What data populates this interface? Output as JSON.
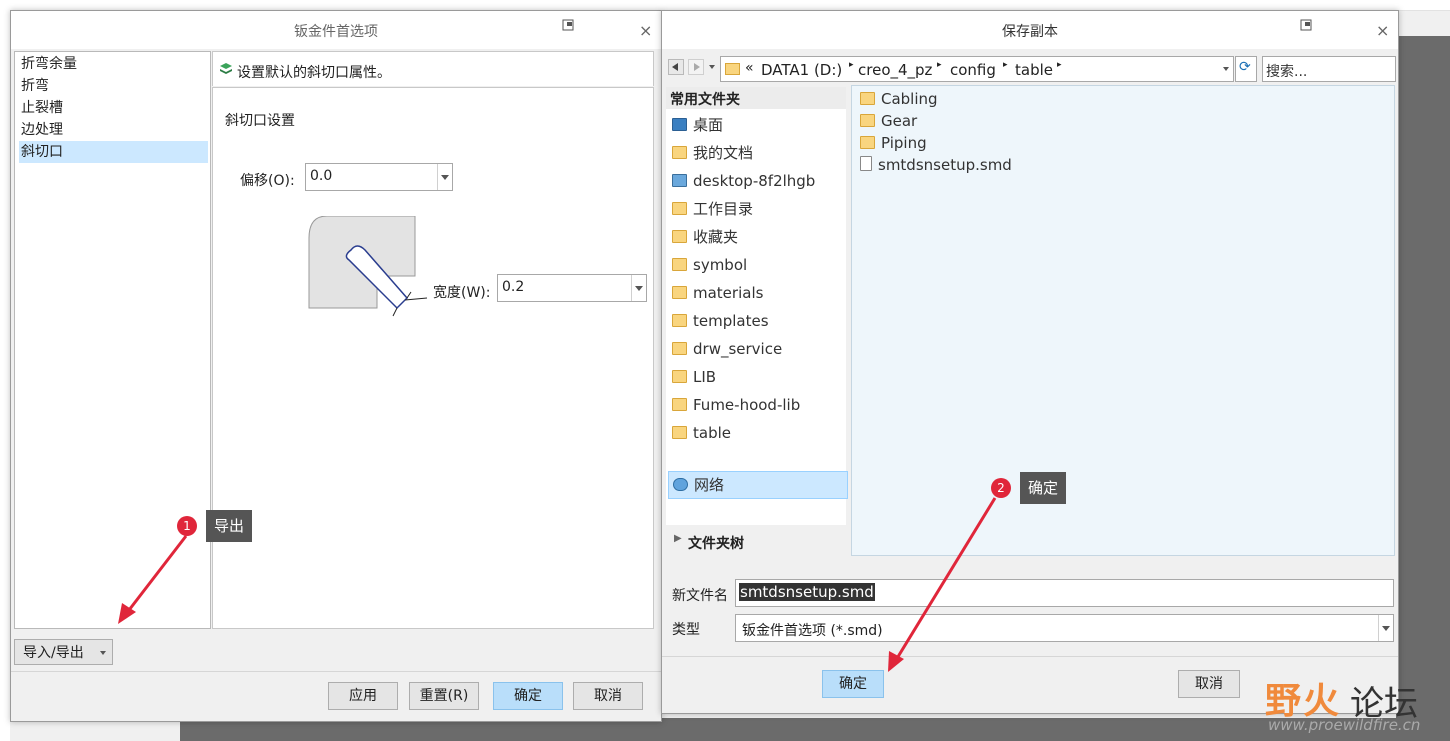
{
  "dialog_left": {
    "title": "钣金件首选项",
    "categories": [
      "折弯余量",
      "折弯",
      "止裂槽",
      "边处理",
      "斜切口"
    ],
    "selected_category": "斜切口",
    "header_text": "设置默认的斜切口属性。",
    "section_title": "斜切口设置",
    "offset_label": "偏移(O):",
    "offset_value": "0.0",
    "width_label": "宽度(W):",
    "width_value": "0.2",
    "import_export_label": "导入/导出",
    "buttons": {
      "apply": "应用",
      "reset": "重置(R)",
      "ok": "确定",
      "cancel": "取消"
    }
  },
  "dialog_right": {
    "title": "保存副本",
    "breadcrumb": [
      "DATA1 (D:)",
      "creo_4_pz",
      "config",
      "table"
    ],
    "breadcrumb_prefix": "«",
    "search_placeholder": "搜索...",
    "favorites_header": "常用文件夹",
    "favorites": [
      "桌面",
      "我的文档",
      "desktop-8f2lhgb",
      "工作目录",
      "收藏夹",
      "symbol",
      "materials",
      "templates",
      "drw_service",
      "LIB",
      "Fume-hood-lib",
      "table"
    ],
    "network_label": "网络",
    "folder_tree_label": "文件夹树",
    "files": [
      "Cabling",
      "Gear",
      "Piping",
      "smtdsnsetup.smd"
    ],
    "filename_label": "新文件名",
    "filename_value": "smtdsnsetup.smd",
    "type_label": "类型",
    "type_value": "钣金件首选项 (*.smd)",
    "ok_label": "确定",
    "cancel_label": "取消"
  },
  "annotations": {
    "callout1_number": "1",
    "callout1_text": "导出",
    "callout2_number": "2",
    "callout2_text": "确定",
    "arrow_color": "#e0263a"
  },
  "watermark": {
    "brand_colored": "野火",
    "brand_dark": "论坛",
    "url": "www.proewildfire.cn"
  }
}
